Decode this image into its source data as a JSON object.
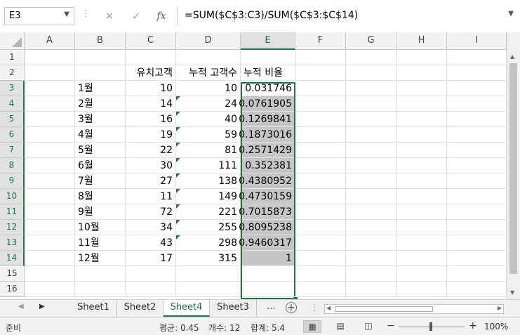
{
  "formula_bar": {
    "name_box": "E3",
    "cancel_symbol": "✕",
    "enter_symbol": "✓",
    "fx_label": "fx",
    "formula": "=SUM($C$3:C3)/SUM($C$3:$C$14)"
  },
  "columns": [
    "A",
    "B",
    "C",
    "D",
    "E",
    "F",
    "G",
    "H",
    "I"
  ],
  "selected_column": "E",
  "rows": [
    "1",
    "2",
    "3",
    "4",
    "5",
    "6",
    "7",
    "8",
    "9",
    "10",
    "11",
    "12",
    "13",
    "14",
    "15",
    "16"
  ],
  "headers": {
    "C": "유치고객",
    "D": "누적 고객수",
    "E": "누적 비율"
  },
  "data_rows": [
    {
      "month": "1월",
      "customers": "10",
      "cumulative": "10",
      "ratio": "0.031746"
    },
    {
      "month": "2월",
      "customers": "14",
      "cumulative": "24",
      "ratio": "0.0761905"
    },
    {
      "month": "3월",
      "customers": "16",
      "cumulative": "40",
      "ratio": "0.1269841"
    },
    {
      "month": "4월",
      "customers": "19",
      "cumulative": "59",
      "ratio": "0.1873016"
    },
    {
      "month": "5월",
      "customers": "22",
      "cumulative": "81",
      "ratio": "0.2571429"
    },
    {
      "month": "6월",
      "customers": "30",
      "cumulative": "111",
      "ratio": "0.352381"
    },
    {
      "month": "7월",
      "customers": "27",
      "cumulative": "138",
      "ratio": "0.4380952"
    },
    {
      "month": "8월",
      "customers": "11",
      "cumulative": "149",
      "ratio": "0.4730159"
    },
    {
      "month": "9월",
      "customers": "72",
      "cumulative": "221",
      "ratio": "0.7015873"
    },
    {
      "month": "10월",
      "customers": "34",
      "cumulative": "255",
      "ratio": "0.8095238"
    },
    {
      "month": "11월",
      "customers": "43",
      "cumulative": "298",
      "ratio": "0.9460317"
    },
    {
      "month": "12월",
      "customers": "17",
      "cumulative": "315",
      "ratio": "1"
    }
  ],
  "sheet_tabs": [
    "Sheet1",
    "Sheet2",
    "Sheet4",
    "Sheet3"
  ],
  "active_sheet": "Sheet4",
  "tab_more": "...",
  "status_bar": {
    "mode": "준비",
    "average": "평균: 0.45",
    "count": "개수: 12",
    "sum": "합계: 5.4",
    "zoom": "100%",
    "zoom_minus": "−",
    "zoom_plus": "+"
  },
  "colors": {
    "accent": "#217346",
    "selection_fill": "#c6c6c6",
    "error_indicator": "#2e7d32"
  },
  "icons": {
    "name_box_dropdown": "chevron-down-icon",
    "formula_expand": "chevron-down-icon",
    "quick_analysis": "quick-analysis-icon",
    "add_sheet": "plus-circle-icon",
    "view_normal": "grid-view-icon",
    "view_page_layout": "page-layout-icon",
    "view_page_break": "page-break-icon"
  }
}
